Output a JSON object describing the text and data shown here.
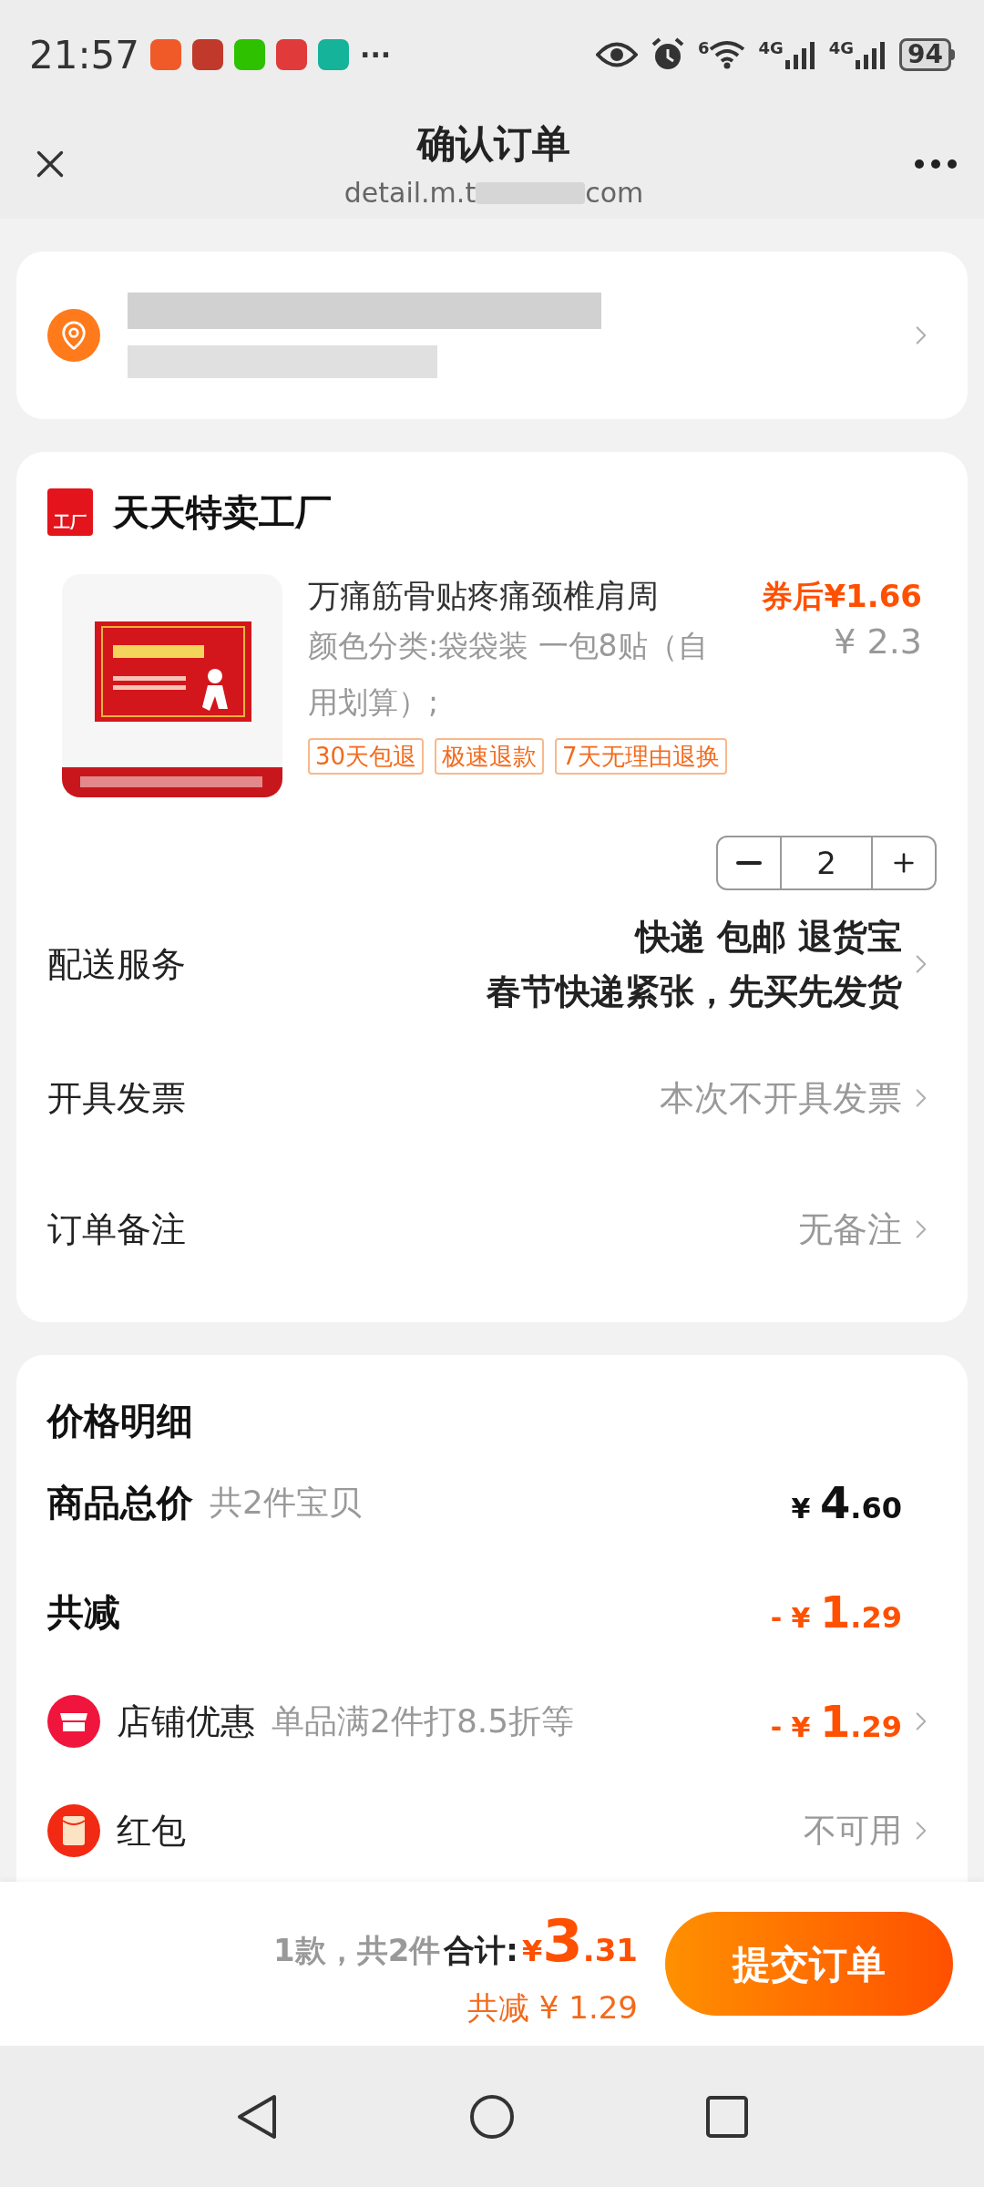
{
  "status_bar": {
    "time": "21:57",
    "more": "···",
    "network_badge": "6",
    "signal_labels": [
      "4G",
      "4G"
    ],
    "battery": "94",
    "app_icons": [
      {
        "color": "#f05a28"
      },
      {
        "color": "#c0392b"
      },
      {
        "color": "#2dc100"
      },
      {
        "color": "#e03a3a"
      },
      {
        "color": "#14b39a"
      }
    ]
  },
  "header": {
    "title": "确认订单",
    "url_start": "detail.m.t",
    "url_end": "com"
  },
  "shop": {
    "name": "天天特卖工厂",
    "badge": "工厂",
    "product": {
      "title": "万痛筋骨贴疼痛颈椎肩周",
      "spec": "颜色分类:袋袋装 一包8贴（自用划算）;",
      "coupon_price": "券后¥1.66",
      "price": "¥ 2.3",
      "tags": [
        "30天包退",
        "极速退款",
        "7天无理由退换"
      ],
      "quantity": "2"
    },
    "rows": [
      {
        "label": "配送服务",
        "values": [
          "快递 包邮 退货宝",
          "春节快递紧张，先买先发货"
        ],
        "kind": "bold"
      },
      {
        "label": "开具发票",
        "values": [
          "本次不开具发票"
        ],
        "kind": "muted"
      },
      {
        "label": "订单备注",
        "values": [
          "无备注"
        ],
        "kind": "muted"
      }
    ]
  },
  "price_detail": {
    "title": "价格明细",
    "rows": [
      {
        "kind": "total",
        "label": "商品总价",
        "note": "共2件宝贝",
        "sign": "",
        "currency": "¥",
        "integer": "4",
        "decimal": ".60"
      },
      {
        "kind": "discount",
        "label": "共减",
        "note": "",
        "sign": "-",
        "currency": "¥",
        "integer": "1",
        "decimal": ".29"
      },
      {
        "kind": "shop",
        "label": "店铺优惠",
        "note": "单品满2件打8.5折等",
        "sign": "-",
        "currency": "¥",
        "integer": "1",
        "decimal": ".29"
      },
      {
        "kind": "redpacket",
        "label": "红包",
        "note": "",
        "text": "不可用"
      }
    ]
  },
  "footer": {
    "count": "1款，共2件",
    "total_label": "合计:",
    "currency": "¥",
    "integer": "3",
    "decimal": ".31",
    "saved": "共减 ¥ 1.29",
    "submit": "提交订单"
  }
}
